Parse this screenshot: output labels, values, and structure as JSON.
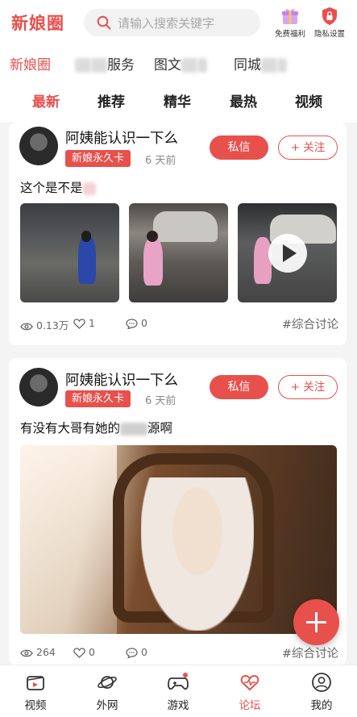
{
  "header": {
    "logo": "新娘圈",
    "search_placeholder": "请输入搜索关键字",
    "free_benefits": "免费福利",
    "privacy_settings": "隐私设置"
  },
  "category_tabs": [
    {
      "label": "新娘圈",
      "active": true
    },
    {
      "label": "有",
      "suffix": "服务"
    },
    {
      "label": "图文",
      "suffix": ""
    },
    {
      "label": "同城",
      "suffix": ""
    }
  ],
  "sub_tabs": [
    {
      "label": "最新",
      "active": true
    },
    {
      "label": "推荐"
    },
    {
      "label": "精华"
    },
    {
      "label": "最热"
    },
    {
      "label": "视频"
    }
  ],
  "posts": [
    {
      "author": "阿姨能认识一下么",
      "badge": "新娘永久卡",
      "time": "6 天前",
      "dm_label": "私信",
      "follow_label": "+ 关注",
      "text": "这个是不是",
      "views": "0.13万",
      "likes": "1",
      "comments": "0",
      "topic": "#综合讨论"
    },
    {
      "author": "阿姨能认识一下么",
      "badge": "新娘永久卡",
      "time": "6 天前",
      "dm_label": "私信",
      "follow_label": "+ 关注",
      "text_a": "有没有大哥有她的",
      "text_b": "源啊",
      "views": "264",
      "likes": "0",
      "comments": "0",
      "topic": "#综合讨论"
    }
  ],
  "bottom_nav": [
    {
      "label": "视频",
      "icon": "video-icon"
    },
    {
      "label": "外网",
      "icon": "planet-icon"
    },
    {
      "label": "游戏",
      "icon": "gamepad-icon"
    },
    {
      "label": "论坛",
      "icon": "heartbeat-icon",
      "active": true
    },
    {
      "label": "我的",
      "icon": "user-icon"
    }
  ],
  "colors": {
    "accent": "#e8504c"
  }
}
